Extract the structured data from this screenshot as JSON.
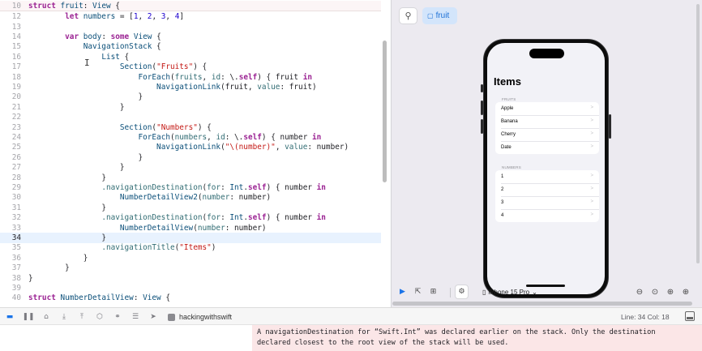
{
  "editor": {
    "cursor_line": "34",
    "lines": [
      {
        "n": "10",
        "indent": "",
        "sticky": true,
        "tokens": [
          [
            "k",
            "struct "
          ],
          [
            "t",
            "fruit"
          ],
          [
            "p",
            ": "
          ],
          [
            "t",
            "View"
          ],
          [
            "p",
            " {"
          ]
        ]
      },
      {
        "n": "12",
        "indent": "        ",
        "tokens": [
          [
            "k",
            "let "
          ],
          [
            "t",
            "numbers"
          ],
          [
            "p",
            " = ["
          ],
          [
            "m",
            "1"
          ],
          [
            "p",
            ", "
          ],
          [
            "m",
            "2"
          ],
          [
            "p",
            ", "
          ],
          [
            "m",
            "3"
          ],
          [
            "p",
            ", "
          ],
          [
            "m",
            "4"
          ],
          [
            "p",
            "]"
          ]
        ]
      },
      {
        "n": "13",
        "indent": "",
        "tokens": []
      },
      {
        "n": "14",
        "indent": "        ",
        "tokens": [
          [
            "k",
            "var "
          ],
          [
            "t",
            "body"
          ],
          [
            "p",
            ": "
          ],
          [
            "k",
            "some "
          ],
          [
            "t",
            "View"
          ],
          [
            "p",
            " {"
          ]
        ]
      },
      {
        "n": "15",
        "indent": "            ",
        "tokens": [
          [
            "t",
            "NavigationStack"
          ],
          [
            "p",
            " {"
          ]
        ]
      },
      {
        "n": "16",
        "indent": "                ",
        "tokens": [
          [
            "t",
            "List"
          ],
          [
            "p",
            " {"
          ]
        ]
      },
      {
        "n": "17",
        "indent": "                    ",
        "tokens": [
          [
            "t",
            "Section"
          ],
          [
            "p",
            "("
          ],
          [
            "s",
            "\"Fruits\""
          ],
          [
            "p",
            ") {"
          ]
        ]
      },
      {
        "n": "18",
        "indent": "                        ",
        "tokens": [
          [
            "t",
            "ForEach"
          ],
          [
            "p",
            "("
          ],
          [
            "f",
            "fruits"
          ],
          [
            "p",
            ", "
          ],
          [
            "f",
            "id"
          ],
          [
            "p",
            ": \\."
          ],
          [
            "k",
            "self"
          ],
          [
            "p",
            ") { fruit "
          ],
          [
            "k",
            "in"
          ]
        ]
      },
      {
        "n": "19",
        "indent": "                            ",
        "tokens": [
          [
            "t",
            "NavigationLink"
          ],
          [
            "p",
            "(fruit, "
          ],
          [
            "f",
            "value"
          ],
          [
            "p",
            ": fruit)"
          ]
        ]
      },
      {
        "n": "20",
        "indent": "                        ",
        "tokens": [
          [
            "p",
            "}"
          ]
        ]
      },
      {
        "n": "21",
        "indent": "                    ",
        "tokens": [
          [
            "p",
            "}"
          ]
        ]
      },
      {
        "n": "22",
        "indent": "",
        "tokens": []
      },
      {
        "n": "23",
        "indent": "                    ",
        "tokens": [
          [
            "t",
            "Section"
          ],
          [
            "p",
            "("
          ],
          [
            "s",
            "\"Numbers\""
          ],
          [
            "p",
            ") {"
          ]
        ]
      },
      {
        "n": "24",
        "indent": "                        ",
        "tokens": [
          [
            "t",
            "ForEach"
          ],
          [
            "p",
            "("
          ],
          [
            "f",
            "numbers"
          ],
          [
            "p",
            ", "
          ],
          [
            "f",
            "id"
          ],
          [
            "p",
            ": \\."
          ],
          [
            "k",
            "self"
          ],
          [
            "p",
            ") { number "
          ],
          [
            "k",
            "in"
          ]
        ]
      },
      {
        "n": "25",
        "indent": "                            ",
        "tokens": [
          [
            "t",
            "NavigationLink"
          ],
          [
            "p",
            "("
          ],
          [
            "s",
            "\"\\(number)\""
          ],
          [
            "p",
            ", "
          ],
          [
            "f",
            "value"
          ],
          [
            "p",
            ": number)"
          ]
        ]
      },
      {
        "n": "26",
        "indent": "                        ",
        "tokens": [
          [
            "p",
            "}"
          ]
        ]
      },
      {
        "n": "27",
        "indent": "                    ",
        "tokens": [
          [
            "p",
            "}"
          ]
        ]
      },
      {
        "n": "28",
        "indent": "                ",
        "tokens": [
          [
            "p",
            "}"
          ]
        ]
      },
      {
        "n": "29",
        "indent": "                ",
        "tokens": [
          [
            "f",
            ".navigationDestination"
          ],
          [
            "p",
            "("
          ],
          [
            "f",
            "for"
          ],
          [
            "p",
            ": "
          ],
          [
            "t",
            "Int"
          ],
          [
            "p",
            "."
          ],
          [
            "k",
            "self"
          ],
          [
            "p",
            ") { number "
          ],
          [
            "k",
            "in"
          ]
        ]
      },
      {
        "n": "30",
        "indent": "                    ",
        "tokens": [
          [
            "t",
            "NumberDetailView2"
          ],
          [
            "p",
            "("
          ],
          [
            "f",
            "number"
          ],
          [
            "p",
            ": number)"
          ]
        ]
      },
      {
        "n": "31",
        "indent": "                ",
        "tokens": [
          [
            "p",
            "}"
          ]
        ]
      },
      {
        "n": "32",
        "indent": "                ",
        "tokens": [
          [
            "f",
            ".navigationDestination"
          ],
          [
            "p",
            "("
          ],
          [
            "f",
            "for"
          ],
          [
            "p",
            ": "
          ],
          [
            "t",
            "Int"
          ],
          [
            "p",
            "."
          ],
          [
            "k",
            "self"
          ],
          [
            "p",
            ") { number "
          ],
          [
            "k",
            "in"
          ]
        ]
      },
      {
        "n": "33",
        "indent": "                    ",
        "tokens": [
          [
            "t",
            "NumberDetailView"
          ],
          [
            "p",
            "("
          ],
          [
            "f",
            "number"
          ],
          [
            "p",
            ": number)"
          ]
        ]
      },
      {
        "n": "34",
        "indent": "                ",
        "current": true,
        "tokens": [
          [
            "p",
            "}"
          ]
        ]
      },
      {
        "n": "35",
        "indent": "                ",
        "tokens": [
          [
            "f",
            ".navigationTitle"
          ],
          [
            "p",
            "("
          ],
          [
            "s",
            "\"Items\""
          ],
          [
            "p",
            ")"
          ]
        ]
      },
      {
        "n": "36",
        "indent": "            ",
        "tokens": [
          [
            "p",
            "}"
          ]
        ]
      },
      {
        "n": "37",
        "indent": "        ",
        "tokens": [
          [
            "p",
            "}"
          ]
        ]
      },
      {
        "n": "38",
        "indent": "",
        "tokens": [
          [
            "p",
            "}"
          ]
        ]
      },
      {
        "n": "39",
        "indent": "",
        "tokens": []
      },
      {
        "n": "40",
        "indent": "",
        "tokens": [
          [
            "k",
            "struct "
          ],
          [
            "t",
            "NumberDetailView"
          ],
          [
            "p",
            ": "
          ],
          [
            "t",
            "View"
          ],
          [
            "p",
            " {"
          ]
        ]
      }
    ]
  },
  "canvas": {
    "pin_icon": "pin-icon",
    "chip_icon": "preview-icon",
    "chip_label": "fruit",
    "device_label": "iPhone 15 Pro",
    "device_icon": "iphone-icon",
    "chevron": "⌄"
  },
  "preview": {
    "nav_title": "Items",
    "fruits_header": "FRUITS",
    "fruits": [
      "Apple",
      "Banana",
      "Cherry",
      "Date"
    ],
    "numbers_header": "NUMBERS",
    "numbers": [
      "1",
      "2",
      "3",
      "4"
    ]
  },
  "debugbar": {
    "project": "hackingwithswift",
    "line_col": "Line: 34  Col: 18"
  },
  "console": {
    "message_line1": "A navigationDestination for “Swift.Int” was declared earlier on the stack. Only the destination",
    "message_line2": "declared closest to the root view of the stack will be used."
  },
  "colors": {
    "accent": "#1a73e8",
    "keyword": "#9b2393",
    "type": "#0b4f79",
    "string": "#c41a16",
    "number": "#1c00cf",
    "warning_bg": "#fbe6e7"
  }
}
